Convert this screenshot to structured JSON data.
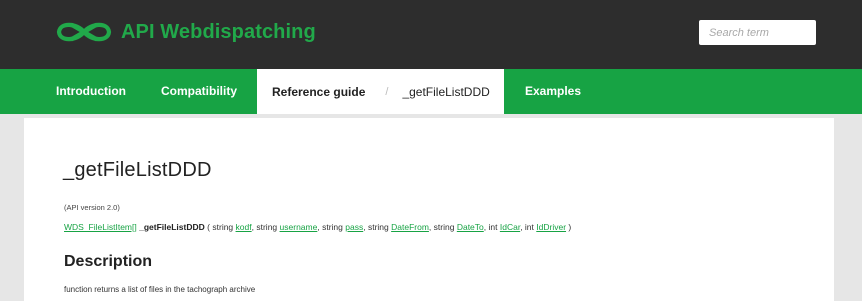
{
  "header": {
    "title": "API Webdispatching",
    "logo_icon": "pretzel-knot-icon",
    "logo_color": "#21a94a",
    "background_color": "#2d2d2d",
    "search": {
      "placeholder": "Search term",
      "value": ""
    }
  },
  "nav": {
    "background_color": "#17a344",
    "items": [
      {
        "label": "Introduction",
        "active": false
      },
      {
        "label": "Compatibility",
        "active": false
      },
      {
        "label": "Reference guide",
        "active": true
      },
      {
        "label": "Examples",
        "active": false
      }
    ],
    "breadcrumb": {
      "separator": "/",
      "current": "_getFileListDDD"
    }
  },
  "main": {
    "title": "_getFileListDDD",
    "api_version": "(API version 2.0)",
    "signature": {
      "return_type": "WDS_FileListItem[]",
      "function_name": "_getFileListDDD",
      "open_paren": "(",
      "close_paren": ")",
      "params": [
        {
          "type": "string",
          "name": "kodf"
        },
        {
          "type": "string",
          "name": "username"
        },
        {
          "type": "string",
          "name": "pass"
        },
        {
          "type": "string",
          "name": "DateFrom"
        },
        {
          "type": "string",
          "name": "DateTo"
        },
        {
          "type": "int",
          "name": "IdCar"
        },
        {
          "type": "int",
          "name": "IdDriver"
        }
      ]
    },
    "description": {
      "heading": "Description",
      "text": "function returns a list of files in the tachograph archive"
    }
  }
}
